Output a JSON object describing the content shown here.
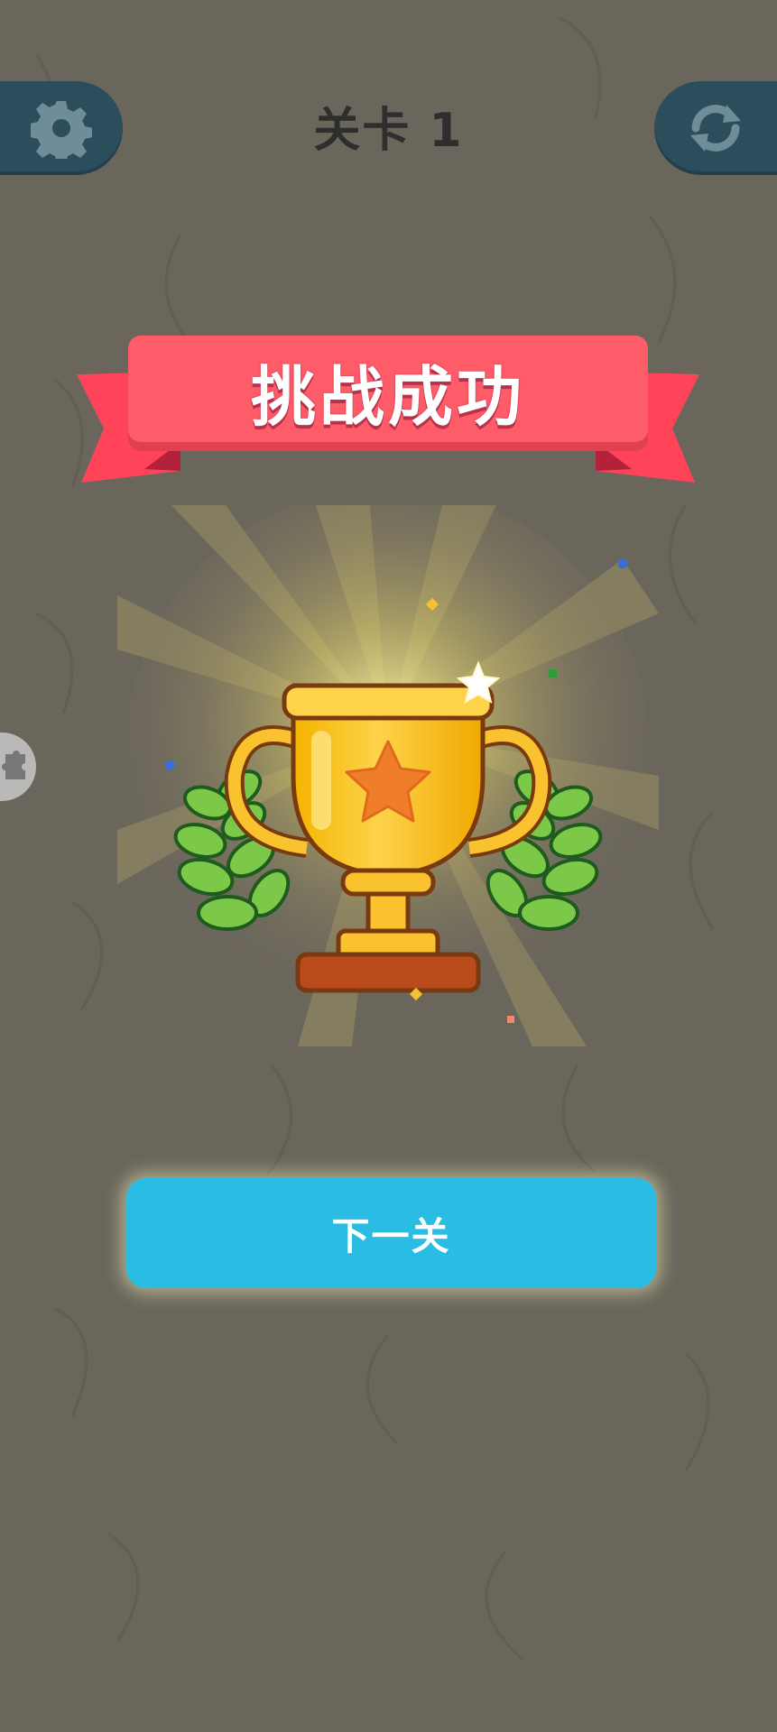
{
  "header": {
    "level_title": "关卡 1",
    "settings_icon": "gear-icon",
    "restart_icon": "refresh-icon"
  },
  "banner": {
    "text": "挑战成功"
  },
  "trophy": {
    "icon": "trophy-icon",
    "decorations": [
      "laurel-left-icon",
      "laurel-right-icon",
      "sparkle-star-icon",
      "confetti"
    ]
  },
  "actions": {
    "next_label": "下一关"
  },
  "side": {
    "icon": "puzzle-icon"
  },
  "colors": {
    "background": "#6b665c",
    "corner_button": "#2c4d5c",
    "banner": "#ff5c6a",
    "ribbon": "#ff4459",
    "trophy_gold": "#f9c22e",
    "star": "#f07d2a",
    "laurel": "#6cc23a",
    "next_button": "#29bde3"
  }
}
